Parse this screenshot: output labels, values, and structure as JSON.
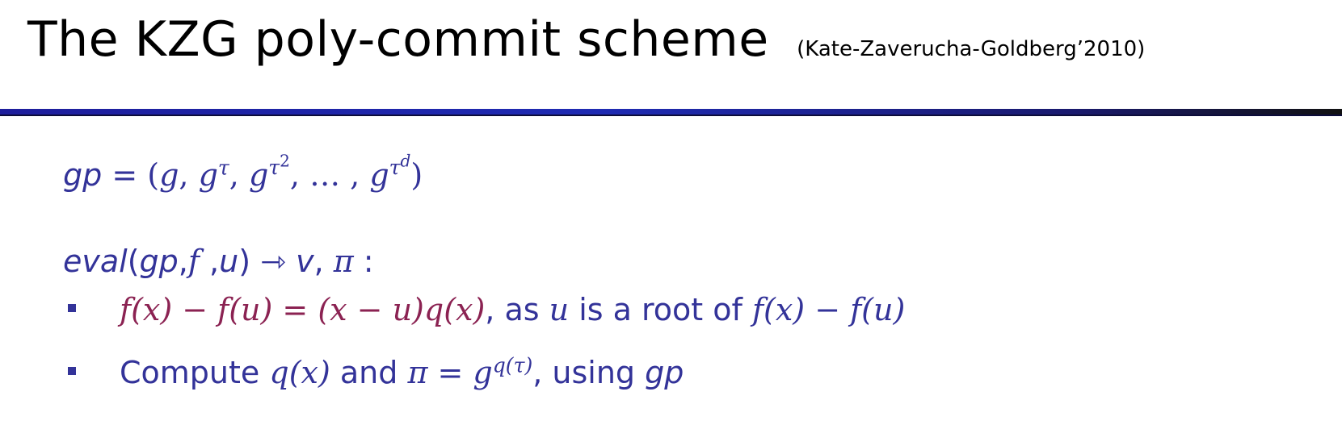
{
  "slide": {
    "title": "The KZG poly-commit scheme",
    "citation": "(Kate-Zaverucha-Goldberg’2010)"
  },
  "colors": {
    "title": "#000000",
    "body": "#333399",
    "math_emphasis": "#8b2252",
    "rule": "#1f2bb3"
  },
  "lines": {
    "gp": {
      "lhs": "gp",
      "eq": " = ",
      "open": "(",
      "g1": "g",
      "comma1": ", ",
      "g2": "g",
      "tau2": "τ",
      "comma2": ", ",
      "g3": "g",
      "tau3": "τ",
      "exp3": "2",
      "comma3": ", … , ",
      "g4": "g",
      "tau4": "τ",
      "exp4": "d",
      "close": ")"
    },
    "eval": {
      "name": "eval",
      "args_open": "(",
      "args_gp": "gp",
      "comma1": ",",
      "f": "f",
      "comma2": " ,",
      "u": "u",
      "args_close": ")",
      "arrow": " ⇾ ",
      "v": "v",
      "comma3": ", ",
      "pi": "π",
      "colon": " :"
    },
    "bullet1": {
      "equation": "f(x) − f(u) = (x − u)q(x)",
      "text_a": ", as ",
      "u": "u",
      "text_b": " is a root of ",
      "tail_math": "f(x) − f(u)"
    },
    "bullet2": {
      "text_a": "Compute ",
      "qx": "q(x)",
      "text_b": " and ",
      "pi": "π",
      "eq": "  = ",
      "g": "g",
      "exp": "q(τ)",
      "text_c": ", using ",
      "gp": "gp"
    }
  }
}
